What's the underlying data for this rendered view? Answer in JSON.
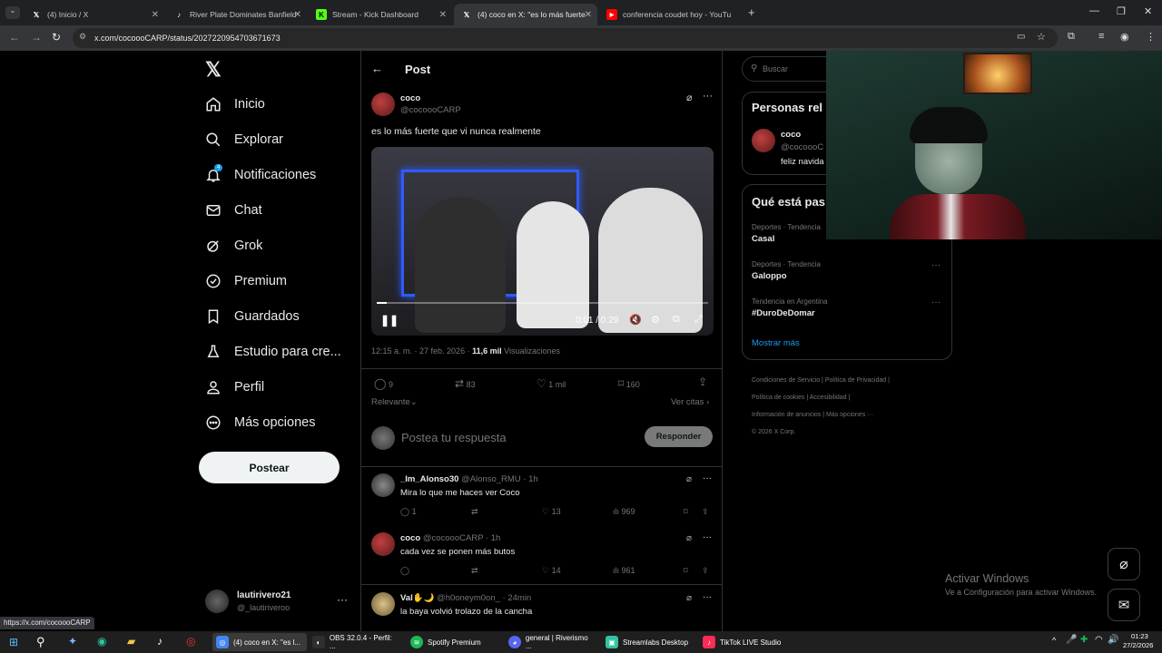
{
  "browser": {
    "tabs": [
      {
        "label": "(4) Inicio / X",
        "fav": "X"
      },
      {
        "label": "River Plate Dominates Banfield",
        "fav": "♪"
      },
      {
        "label": "Stream - Kick Dashboard",
        "fav": "K"
      },
      {
        "label": "(4) coco en X: \"es lo más fuerte",
        "fav": "X"
      },
      {
        "label": "conferencia coudet hoy - YouTu",
        "fav": "▶"
      }
    ],
    "url": "x.com/cocoooCARP/status/2027220954703671673",
    "status_url": "https://x.com/cocoooCARP"
  },
  "nav": {
    "items": [
      {
        "label": "Inicio"
      },
      {
        "label": "Explorar"
      },
      {
        "label": "Notificaciones",
        "badge": "4"
      },
      {
        "label": "Chat"
      },
      {
        "label": "Grok"
      },
      {
        "label": "Premium"
      },
      {
        "label": "Guardados"
      },
      {
        "label": "Estudio para cre..."
      },
      {
        "label": "Perfil"
      },
      {
        "label": "Más opciones"
      }
    ],
    "post_button": "Postear",
    "account": {
      "name": "lautirivero21",
      "handle": "@_lautiriveroo"
    }
  },
  "post": {
    "header": "Post",
    "author": {
      "name": "coco",
      "handle": "@cocoooCARP"
    },
    "text": "es lo más fuerte que vi nunca realmente",
    "video": {
      "time": "0:01 / 0:29",
      "progress": 0.03
    },
    "meta_time": "12:15 a. m. · 27 feb. 2026 ·",
    "views": "11,6 mil",
    "views_label": "Visualizaciones",
    "stats": {
      "replies": "9",
      "reposts": "83",
      "likes": "1 mil",
      "bookmarks": "160"
    },
    "sort": "Relevante",
    "quotes": "Ver citas",
    "reply_placeholder": "Postea tu respuesta",
    "reply_button": "Responder"
  },
  "replies": [
    {
      "name": "_Im_Alonso30",
      "handle": "@Alonso_RMU · 1h",
      "text": "Mira lo que me haces ver Coco",
      "replies": "1",
      "reposts": "",
      "likes": "13",
      "views": "969"
    },
    {
      "name": "coco",
      "handle": "@cocoooCARP · 1h",
      "text": "cada vez se ponen más butos",
      "replies": "",
      "reposts": "",
      "likes": "14",
      "views": "961"
    },
    {
      "name": "Val✋🌙",
      "handle": "@h0oneym0on_ · 24min",
      "text": "la baya volvió trolazo de la cancha",
      "replies": "",
      "reposts": "",
      "likes": "",
      "views": ""
    }
  ],
  "right": {
    "search_placeholder": "Buscar",
    "related_title": "Personas rel",
    "related_person": {
      "name": "coco",
      "handle": "@cocoooC",
      "bio": "feliz navida"
    },
    "trends_title": "Qué está pas",
    "trends": [
      {
        "context": "Deportes · Tendencia",
        "name": "Casal"
      },
      {
        "context": "Deportes · Tendencia",
        "name": "Galoppo"
      },
      {
        "context": "Tendencia en Argentina",
        "name": "#DuroDeDomar"
      }
    ],
    "show_more": "Mostrar más",
    "footer": [
      "Condiciones de Servicio",
      "Política de Privacidad",
      "Política de cookies",
      "Accesibilidad",
      "Información de anuncios",
      "Más opciones ···",
      "© 2026 X Corp."
    ]
  },
  "watermark": {
    "line1": "Activar Windows",
    "line2": "Ve a Configuración para activar Windows."
  },
  "taskbar": {
    "apps": [
      {
        "label": "(4) coco en X: \"es l...",
        "color": "#4285f4"
      },
      {
        "label": "OBS 32.0.4 - Perfil: ...",
        "color": "#302e31"
      },
      {
        "label": "Spotify Premium",
        "color": "#1db954"
      },
      {
        "label": "general | Riverismo ...",
        "color": "#5865f2"
      },
      {
        "label": "Streamlabs Desktop",
        "color": "#31c3a2"
      },
      {
        "label": "TikTok LIVE Studio",
        "color": "#fe2c55"
      }
    ],
    "time": "01:23",
    "date": "27/2/2026"
  },
  "colors": {
    "accent": "#1d9bf0",
    "bg": "#000000",
    "border": "#2f3336",
    "muted": "#71767b"
  }
}
